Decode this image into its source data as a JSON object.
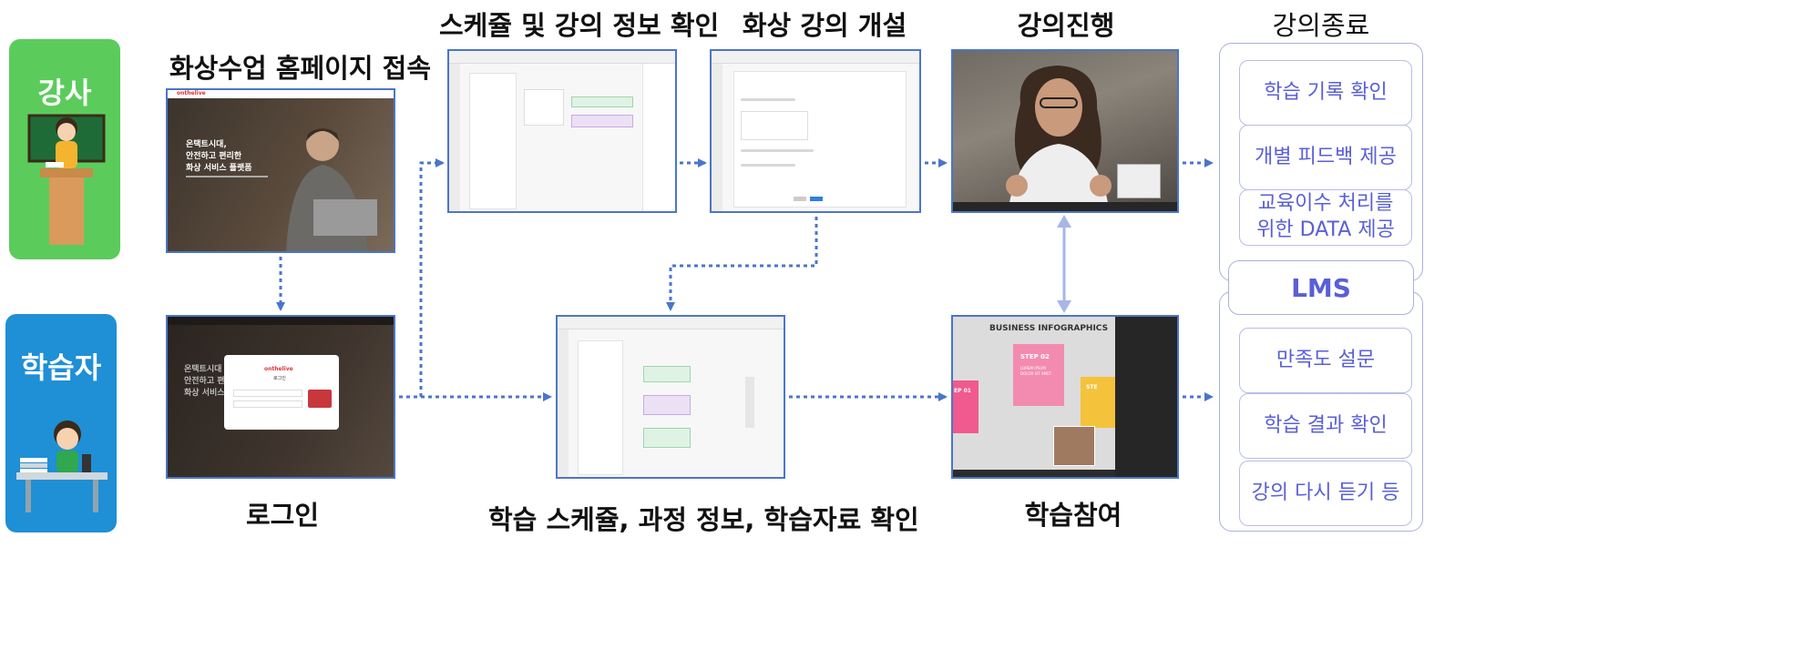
{
  "roles": {
    "instructor": "강사",
    "learner": "학습자"
  },
  "steps": {
    "homepage": "화상수업 홈페이지 접속",
    "login": "로그인",
    "schedule_check": "스케쥴 및 강의 정보 확인",
    "open_lecture": "화상 강의 개설",
    "lecture_progress": "강의진행",
    "lecture_end": "강의종료",
    "learner_schedule": "학습 스케쥴, 과정 정보, 학습자료 확인",
    "learning_participation": "학습참여"
  },
  "homepage_screen": {
    "brand": "onthelive",
    "headline_1": "온택트시대,",
    "headline_2": "안전하고 편리한",
    "headline_3": "화상 서비스 플랫폼"
  },
  "login_screen": {
    "brand": "onthelive",
    "dialog_title": "로그인",
    "headline_1": "온택트시대",
    "headline_2": "안전하고 편",
    "headline_3": "화상 서비스"
  },
  "infographic": {
    "title": "BUSINESS INFOGRAPHICS",
    "step_title": "STEP 02",
    "step_body_1": "LOREM IPSUM",
    "step_body_2": "DOLOR SIT AMET",
    "left_title": "EP 01",
    "right_title": "STE"
  },
  "lms": {
    "label": "LMS",
    "top_items": [
      "학습 기록 확인",
      "개별 피드백 제공",
      "교육이수 처리를\n위한 DATA 제공"
    ],
    "bottom_items": [
      "만족도 설문",
      "학습 결과 확인",
      "강의 다시 듣기 등"
    ]
  },
  "colors": {
    "instructor": "#5bcc5b",
    "learner": "#1f8fd6",
    "arrow": "#4a76c9",
    "lms_text": "#5a5fd6"
  }
}
